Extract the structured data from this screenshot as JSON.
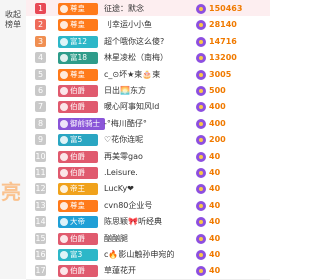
{
  "sidebar": {
    "label": "收起榜单",
    "watermark": "亮"
  },
  "rows": [
    {
      "rank": "1",
      "badge": "尊皇",
      "badge_color": "#ff7a1a",
      "name": "征途：默念",
      "score": "150463"
    },
    {
      "rank": "2",
      "badge": "尊皇",
      "badge_color": "#ff7a1a",
      "name": "刂幸运小小鱼",
      "score": "28140"
    },
    {
      "rank": "3",
      "badge": "富12",
      "badge_color": "#2db7c8",
      "name": "超个哦你这么傻?",
      "score": "14716"
    },
    {
      "rank": "4",
      "badge": "富18",
      "badge_color": "#2e9c8a",
      "name": "林星凌松（南梅）",
      "score": "13200"
    },
    {
      "rank": "5",
      "badge": "尊皇",
      "badge_color": "#ff7a1a",
      "name": "c_⊙坏★柬🎂柬",
      "score": "3005"
    },
    {
      "rank": "6",
      "badge": "伯爵",
      "badge_color": "#e05a6e",
      "name": "日出🌅东方",
      "score": "500"
    },
    {
      "rank": "7",
      "badge": "伯爵",
      "badge_color": "#e05a6e",
      "name": "暖心阿事知风ld",
      "score": "400"
    },
    {
      "rank": "8",
      "badge": "御前骑士",
      "badge_color": "#8a55d8",
      "name": "-°梅川酷仔°",
      "score": "400"
    },
    {
      "rank": "9",
      "badge": "富5",
      "badge_color": "#2aa6c2",
      "name": "♡花你连呢",
      "score": "200"
    },
    {
      "rank": "10",
      "badge": "伯爵",
      "badge_color": "#e05a6e",
      "name": "再美零gao",
      "score": "40"
    },
    {
      "rank": "11",
      "badge": "伯爵",
      "badge_color": "#e05a6e",
      "name": ".Leisure.",
      "score": "40"
    },
    {
      "rank": "12",
      "badge": "帝王",
      "badge_color": "#f0a21c",
      "name": "LucKy❤",
      "score": "40"
    },
    {
      "rank": "13",
      "badge": "尊皇",
      "badge_color": "#ff7a1a",
      "name": "cvn80企业号",
      "score": "40"
    },
    {
      "rank": "14",
      "badge": "大帝",
      "badge_color": "#1f9fd6",
      "name": "陈思颖🎀听经典",
      "score": "40"
    },
    {
      "rank": "15",
      "badge": "伯爵",
      "badge_color": "#e05a6e",
      "name": "酗酗腿",
      "score": "40"
    },
    {
      "rank": "16",
      "badge": "富3",
      "badge_color": "#2db7c8",
      "name": "c🔥影山触孙申宛的",
      "score": "40"
    },
    {
      "rank": "17",
      "badge": "伯爵",
      "badge_color": "#e05a6e",
      "name": "草蓮花开",
      "score": "40"
    }
  ]
}
